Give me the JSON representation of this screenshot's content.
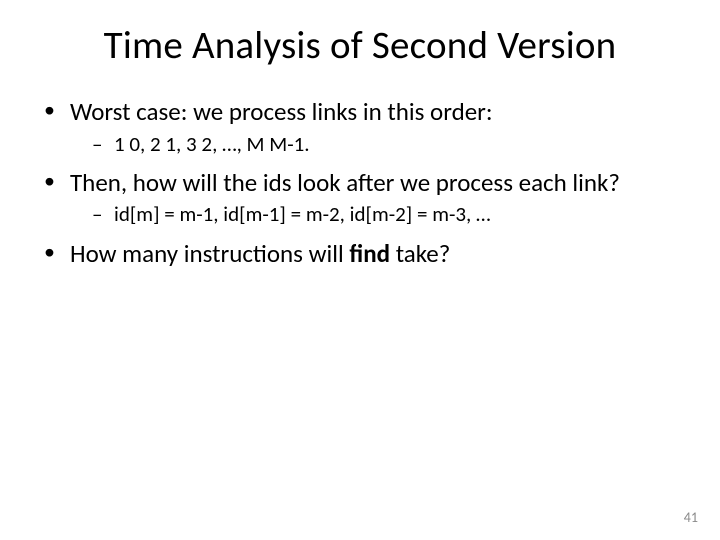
{
  "title": "Time Analysis of Second Version",
  "bullets": {
    "b1": "Worst case: we process links in this order:",
    "b1_sub": " 1 0, 2 1, 3 2, …, M M-1.",
    "b2": "Then, how will the ids look after we process each link?",
    "b2_sub": "id[m] = m-1, id[m-1] = m-2, id[m-2] = m-3, …",
    "b3_pre": "How many instructions will ",
    "b3_bold": "find",
    "b3_post": " take?"
  },
  "page_number": "41"
}
